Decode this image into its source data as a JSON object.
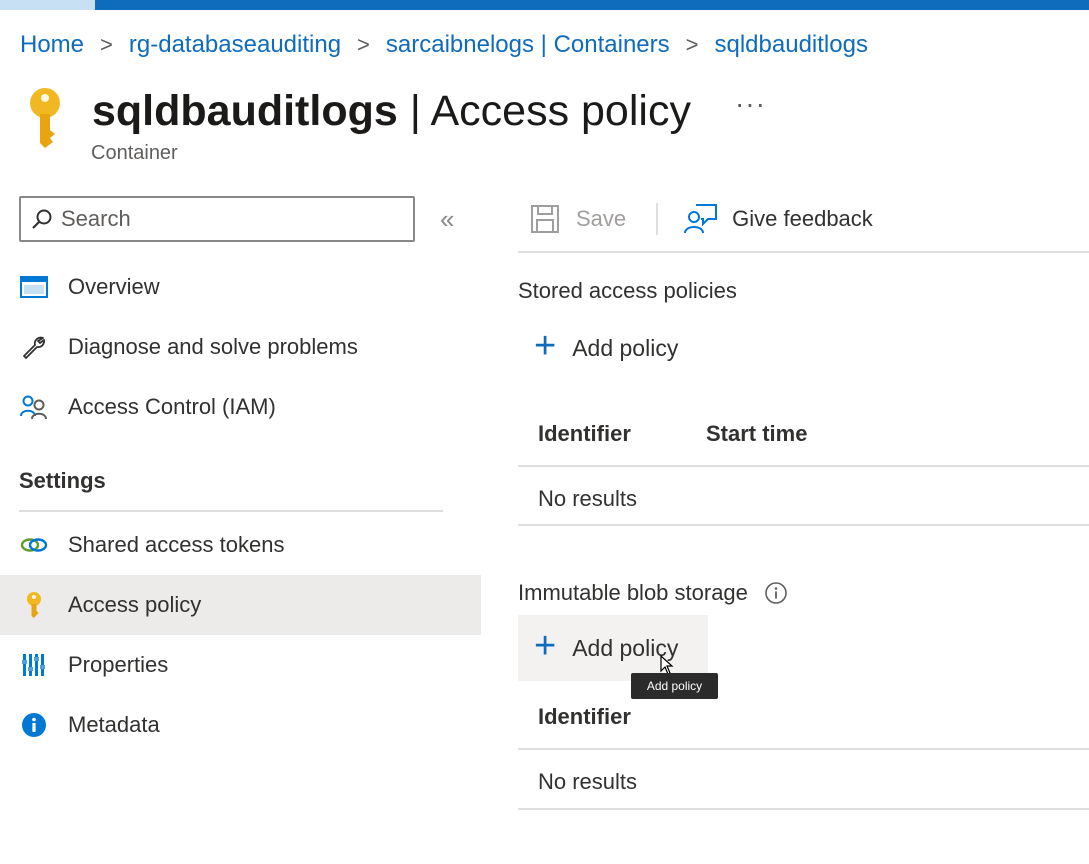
{
  "breadcrumb": {
    "items": [
      "Home",
      "rg-databaseauditing",
      "sarcaibnelogs | Containers",
      "sqldbauditlogs"
    ],
    "separator": ">"
  },
  "header": {
    "title_name": "sqldbauditlogs",
    "title_suffix": " | Access policy",
    "more": "···",
    "subtitle": "Container"
  },
  "sidebar": {
    "search_placeholder": "Search",
    "collapse": "«",
    "items": [
      {
        "label": "Overview",
        "icon": "overview-icon"
      },
      {
        "label": "Diagnose and solve problems",
        "icon": "wrench-icon"
      },
      {
        "label": "Access Control (IAM)",
        "icon": "people-icon"
      }
    ],
    "settings_heading": "Settings",
    "settings_items": [
      {
        "label": "Shared access tokens",
        "icon": "link-icon"
      },
      {
        "label": "Access policy",
        "icon": "key-icon",
        "active": true
      },
      {
        "label": "Properties",
        "icon": "properties-icon"
      },
      {
        "label": "Metadata",
        "icon": "info-icon"
      }
    ]
  },
  "toolbar": {
    "save_label": "Save",
    "feedback_label": "Give feedback"
  },
  "stored_policies": {
    "title": "Stored access policies",
    "add_label": "Add policy",
    "columns": [
      "Identifier",
      "Start time"
    ],
    "empty": "No results"
  },
  "immutable": {
    "title": "Immutable blob storage",
    "add_label": "Add policy",
    "columns": [
      "Identifier"
    ],
    "empty": "No results",
    "tooltip": "Add policy"
  },
  "colors": {
    "accent": "#0f6cbd",
    "key": "#f2b824",
    "active_bg": "#edebe9"
  }
}
